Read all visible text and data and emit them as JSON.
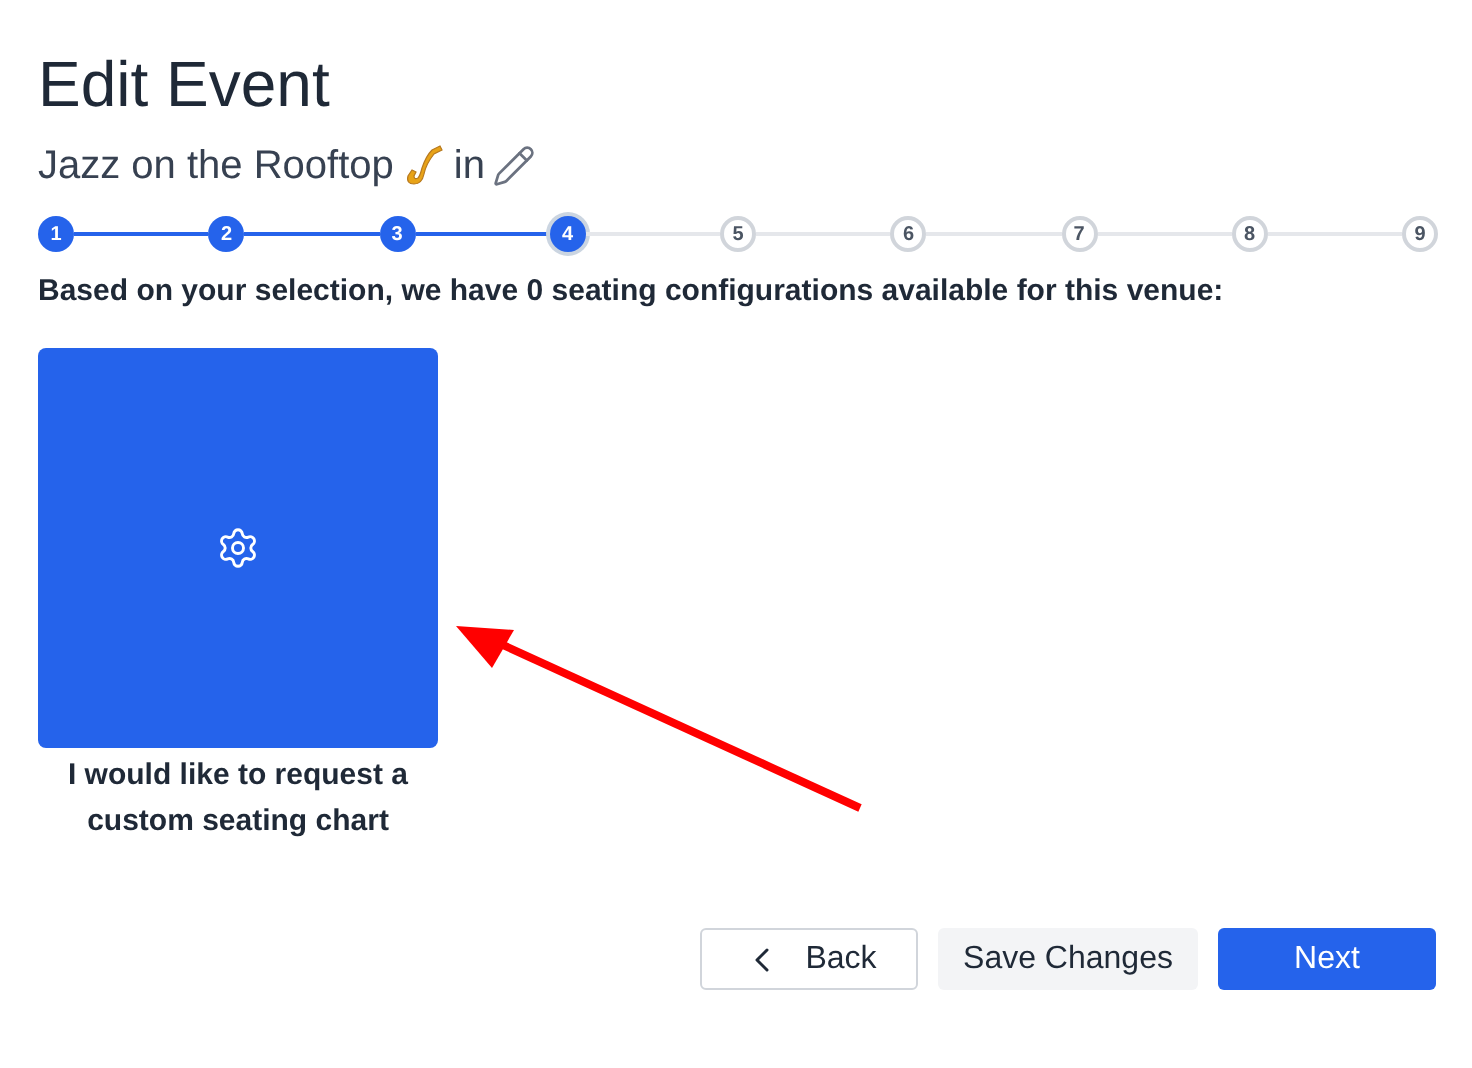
{
  "title": "Edit Event",
  "subtitle": {
    "event_name": "Jazz on the Rooftop",
    "connector": "in"
  },
  "steps": [
    {
      "label": "1",
      "completed": true,
      "selected": false
    },
    {
      "label": "2",
      "completed": true,
      "selected": false
    },
    {
      "label": "3",
      "completed": true,
      "selected": false
    },
    {
      "label": "4",
      "completed": false,
      "selected": true
    },
    {
      "label": "5",
      "completed": false,
      "selected": false
    },
    {
      "label": "6",
      "completed": false,
      "selected": false
    },
    {
      "label": "7",
      "completed": false,
      "selected": false
    },
    {
      "label": "8",
      "completed": false,
      "selected": false
    },
    {
      "label": "9",
      "completed": false,
      "selected": false
    }
  ],
  "message": "Based on your selection, we have 0 seating configurations available for this venue:",
  "options": [
    {
      "caption": "I would like to request a custom seating chart",
      "selected": true
    }
  ],
  "buttons": [
    {
      "label": "Back",
      "kind": "back"
    },
    {
      "label": "Save Changes",
      "kind": "secondary"
    },
    {
      "label": "Next",
      "kind": "primary"
    }
  ]
}
